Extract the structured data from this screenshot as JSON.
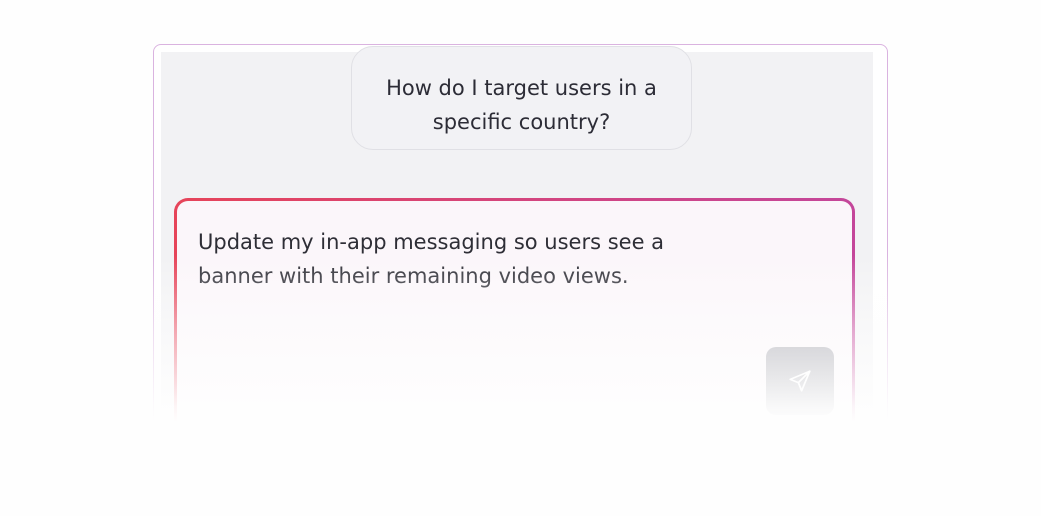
{
  "suggestion": {
    "text": "How do I target users in a specific country?"
  },
  "composer": {
    "value": "Update my in-app messaging so users see a banner with their remaining video views.",
    "send_icon": "send-icon"
  },
  "colors": {
    "composer_border_start": "#e64459",
    "composer_border_end": "#c4469a",
    "panel_border": "#dab3e0",
    "send_button": "#9a9aa4"
  }
}
